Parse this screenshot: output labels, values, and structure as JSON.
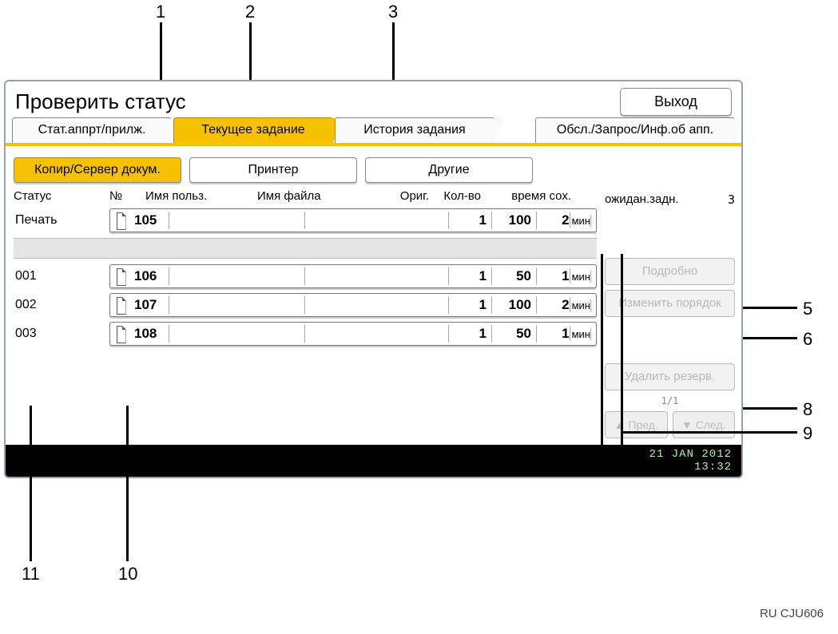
{
  "callouts": {
    "top": [
      "1",
      "2",
      "3"
    ],
    "right": [
      "5",
      "6",
      "8",
      "9"
    ],
    "bottom": [
      "11",
      "10"
    ]
  },
  "title": "Проверить статус",
  "exit": "Выход",
  "main_tabs": {
    "t0": "Стат.аппрт/прилж.",
    "t1": "Текущее задание",
    "t2": "История задания",
    "t3": "Обсл./Запрос/Инф.об апп."
  },
  "func_tabs": {
    "f0": "Копир/Сервер докум.",
    "f1": "Принтер",
    "f2": "Другие"
  },
  "headers": {
    "status": "Статус",
    "no": "№",
    "user": "Имя польз.",
    "file": "Имя файла",
    "orig": "Ориг.",
    "qty": "Кол-во",
    "time": "время сох.",
    "wait": "ожидан.задн.",
    "wait_count": "3"
  },
  "status_printing": "Печать",
  "unit_min": "мин",
  "jobs": {
    "current": {
      "no": "105",
      "user": "",
      "file": "",
      "orig": "1",
      "qty": "100",
      "time": "2"
    },
    "q": [
      {
        "idx": "001",
        "no": "106",
        "user": "",
        "file": "",
        "orig": "1",
        "qty": "50",
        "time": "1"
      },
      {
        "idx": "002",
        "no": "107",
        "user": "",
        "file": "",
        "orig": "1",
        "qty": "100",
        "time": "2"
      },
      {
        "idx": "003",
        "no": "108",
        "user": "",
        "file": "",
        "orig": "1",
        "qty": "50",
        "time": "1"
      }
    ]
  },
  "side": {
    "details": "Подробно",
    "reorder": "Изменить порядок",
    "delete": "Удалить резерв.",
    "pager": "1/1",
    "prev": "Пред.",
    "next": "След."
  },
  "statusbar": {
    "date": "21 JAN  2012",
    "time": "13:32"
  },
  "figure_code": "RU CJU606"
}
